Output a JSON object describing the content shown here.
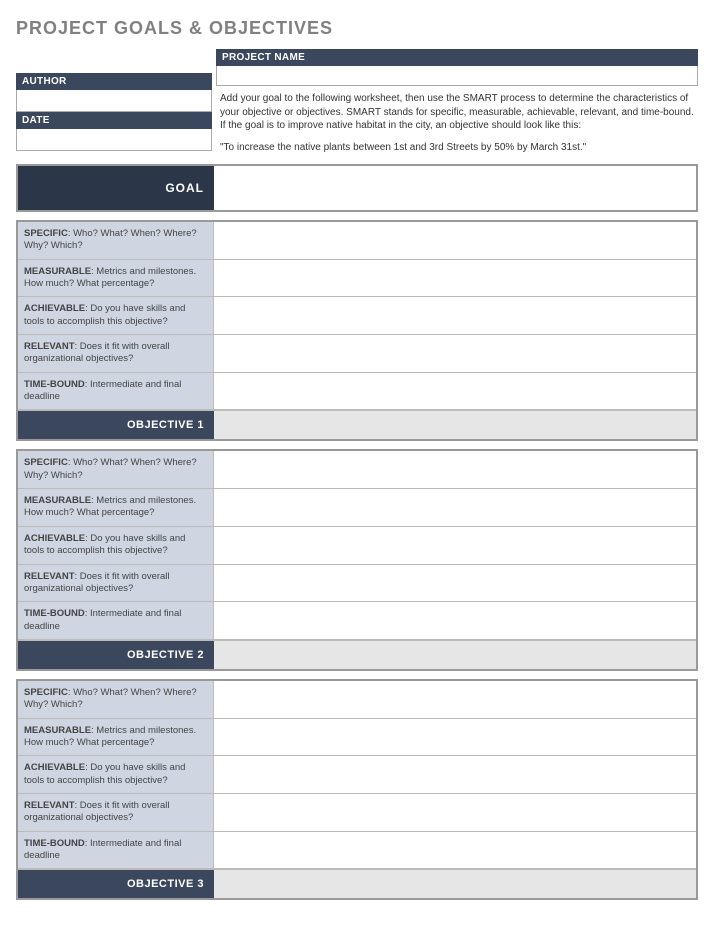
{
  "title": "PROJECT GOALS & OBJECTIVES",
  "fields": {
    "project_name_label": "PROJECT NAME",
    "author_label": "AUTHOR",
    "date_label": "DATE",
    "project_name_value": "",
    "author_value": "",
    "date_value": ""
  },
  "instructions": {
    "body": "Add your goal to the following worksheet, then use the SMART process to determine the characteristics of your objective or objectives. SMART stands for specific, measurable, achievable, relevant, and time-bound. If the goal is to improve native habitat in the city, an objective should look like this:",
    "example": "\"To increase the native plants between 1st and 3rd Streets by 50% by March 31st.\""
  },
  "goal": {
    "label": "GOAL",
    "value": ""
  },
  "smart_labels": {
    "specific_strong": "SPECIFIC",
    "specific_rest": ": Who? What? When? Where? Why? Which?",
    "measurable_strong": "MEASURABLE",
    "measurable_rest": ": Metrics and milestones. How much? What percentage?",
    "achievable_strong": "ACHIEVABLE",
    "achievable_rest": ": Do you have skills and tools to accomplish this objective?",
    "relevant_strong": "RELEVANT",
    "relevant_rest": ": Does it fit with overall organizational objectives?",
    "timebound_strong": "TIME-BOUND",
    "timebound_rest": ": Intermediate and final deadline"
  },
  "objectives": {
    "obj1_label": "OBJECTIVE 1",
    "obj2_label": "OBJECTIVE 2",
    "obj3_label": "OBJECTIVE 3"
  }
}
